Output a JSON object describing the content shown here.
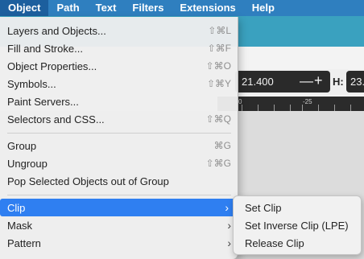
{
  "menubar": {
    "items": [
      "Object",
      "Path",
      "Text",
      "Filters",
      "Extensions",
      "Help"
    ]
  },
  "background": {
    "width_value": "21.400",
    "h_label": "H:",
    "h_value": "23.",
    "ruler_left": "0",
    "ruler_mark": "-25"
  },
  "menu": {
    "items": [
      {
        "label": "Layers and Objects...",
        "shortcut": "⇧⌘L"
      },
      {
        "label": "Fill and Stroke...",
        "shortcut": "⇧⌘F"
      },
      {
        "label": "Object Properties...",
        "shortcut": "⇧⌘O"
      },
      {
        "label": "Symbols...",
        "shortcut": "⇧⌘Y"
      },
      {
        "label": "Paint Servers...",
        "shortcut": ""
      },
      {
        "label": "Selectors and CSS...",
        "shortcut": "⇧⌘Q"
      },
      {
        "label": "Group",
        "shortcut": "⌘G"
      },
      {
        "label": "Ungroup",
        "shortcut": "⇧⌘G"
      },
      {
        "label": "Pop Selected Objects out of Group",
        "shortcut": ""
      },
      {
        "label": "Clip",
        "shortcut": ""
      },
      {
        "label": "Mask",
        "shortcut": ""
      },
      {
        "label": "Pattern",
        "shortcut": ""
      }
    ]
  },
  "submenu": {
    "items": [
      "Set Clip",
      "Set Inverse Clip (LPE)",
      "Release Clip"
    ]
  },
  "colors": {
    "menubar": "#2f7fbf",
    "highlight": "#2f7ff1",
    "teal_band": "#3aa1bf"
  }
}
